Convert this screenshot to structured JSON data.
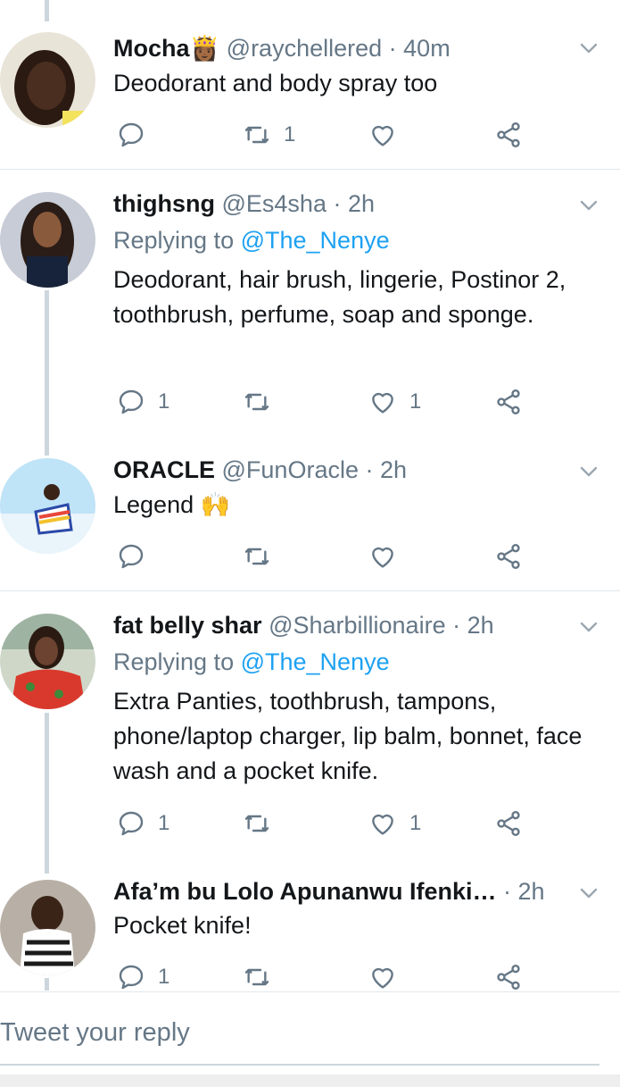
{
  "tweets": [
    {
      "name": "Mocha",
      "emoji": "👸🏾",
      "handle": "@raychellered",
      "time": "· 40m",
      "replying_label": "",
      "replying_handle": "",
      "text": "Deodorant and body spray too",
      "replies": "",
      "retweets": "1",
      "likes": ""
    },
    {
      "name": "thighsng",
      "emoji": "",
      "handle": "@Es4sha",
      "time": "· 2h",
      "replying_label": "Replying to",
      "replying_handle": "@The_Nenye",
      "text": "Deodorant, hair brush, lingerie, Postinor 2, toothbrush, perfume, soap and sponge.",
      "replies": "1",
      "retweets": "",
      "likes": "1"
    },
    {
      "name": "ORACLE",
      "emoji": "",
      "handle": "@FunOracle",
      "time": "· 2h",
      "replying_label": "",
      "replying_handle": "",
      "text": "Legend 🙌",
      "replies": "",
      "retweets": "",
      "likes": ""
    },
    {
      "name": "fat belly shar",
      "emoji": "",
      "handle": "@Sharbillionaire",
      "time": "· 2h",
      "replying_label": "Replying to",
      "replying_handle": "@The_Nenye",
      "text": "Extra Panties, toothbrush, tampons, phone/laptop charger, lip balm, bonnet, face wash and a pocket knife.",
      "replies": "1",
      "retweets": "",
      "likes": "1"
    },
    {
      "name": "Afa’m bu Lolo Apunanwu Ifenki…",
      "emoji": "",
      "handle": "",
      "time": "· 2h",
      "replying_label": "",
      "replying_handle": "",
      "text": "Pocket knife!",
      "replies": "1",
      "retweets": "",
      "likes": ""
    }
  ],
  "compose": {
    "placeholder": "Tweet your reply"
  },
  "colors": {
    "link": "#1da1f2",
    "muted": "#657786",
    "divider": "#e1e8ed",
    "thread": "#ccd6dd"
  },
  "icons": [
    "reply-icon",
    "retweet-icon",
    "like-icon",
    "share-icon",
    "chevron-down-icon"
  ]
}
